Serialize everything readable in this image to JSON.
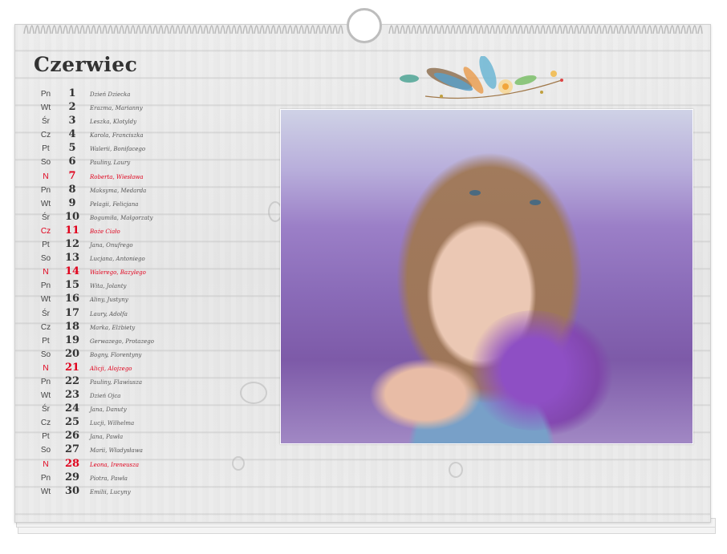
{
  "calendar": {
    "month": "Czerwiec",
    "days": [
      {
        "wd": "Pn",
        "num": "1",
        "name": "Dzień Dziecka",
        "holiday": false
      },
      {
        "wd": "Wt",
        "num": "2",
        "name": "Erazma, Marianny",
        "holiday": false
      },
      {
        "wd": "Śr",
        "num": "3",
        "name": "Leszka, Klotyldy",
        "holiday": false
      },
      {
        "wd": "Cz",
        "num": "4",
        "name": "Karola, Franciszka",
        "holiday": false
      },
      {
        "wd": "Pt",
        "num": "5",
        "name": "Walerii, Bonifacego",
        "holiday": false
      },
      {
        "wd": "So",
        "num": "6",
        "name": "Pauliny, Laury",
        "holiday": false
      },
      {
        "wd": "N",
        "num": "7",
        "name": "Roberta, Wiesława",
        "holiday": true
      },
      {
        "wd": "Pn",
        "num": "8",
        "name": "Maksyma, Medarda",
        "holiday": false
      },
      {
        "wd": "Wt",
        "num": "9",
        "name": "Pelagii, Felicjana",
        "holiday": false
      },
      {
        "wd": "Śr",
        "num": "10",
        "name": "Bogumiła, Małgorzaty",
        "holiday": false
      },
      {
        "wd": "Cz",
        "num": "11",
        "name": "Boże Ciało",
        "holiday": true
      },
      {
        "wd": "Pt",
        "num": "12",
        "name": "Jana, Onufrego",
        "holiday": false
      },
      {
        "wd": "So",
        "num": "13",
        "name": "Lucjana, Antoniego",
        "holiday": false
      },
      {
        "wd": "N",
        "num": "14",
        "name": "Walerego, Bazylego",
        "holiday": true
      },
      {
        "wd": "Pn",
        "num": "15",
        "name": "Wita, Jolanty",
        "holiday": false
      },
      {
        "wd": "Wt",
        "num": "16",
        "name": "Aliny, Justyny",
        "holiday": false
      },
      {
        "wd": "Śr",
        "num": "17",
        "name": "Laury, Adolfa",
        "holiday": false
      },
      {
        "wd": "Cz",
        "num": "18",
        "name": "Marka, Elżbiety",
        "holiday": false
      },
      {
        "wd": "Pt",
        "num": "19",
        "name": "Gerwazego, Protazego",
        "holiday": false
      },
      {
        "wd": "So",
        "num": "20",
        "name": "Bogny, Florentyny",
        "holiday": false
      },
      {
        "wd": "N",
        "num": "21",
        "name": "Alicji, Alojzego",
        "holiday": true
      },
      {
        "wd": "Pn",
        "num": "22",
        "name": "Pauliny, Flawiusza",
        "holiday": false
      },
      {
        "wd": "Wt",
        "num": "23",
        "name": "Dzień Ojca",
        "holiday": false
      },
      {
        "wd": "Śr",
        "num": "24",
        "name": "Jana, Danuty",
        "holiday": false
      },
      {
        "wd": "Cz",
        "num": "25",
        "name": "Lucji, Wilhelma",
        "holiday": false
      },
      {
        "wd": "Pt",
        "num": "26",
        "name": "Jana, Pawła",
        "holiday": false
      },
      {
        "wd": "So",
        "num": "27",
        "name": "Marii, Władysława",
        "holiday": false
      },
      {
        "wd": "N",
        "num": "28",
        "name": "Leona, Ireneusza",
        "holiday": true
      },
      {
        "wd": "Pn",
        "num": "29",
        "name": "Piotra, Pawła",
        "holiday": false
      },
      {
        "wd": "Wt",
        "num": "30",
        "name": "Emilii, Lucyny",
        "holiday": false
      }
    ]
  },
  "colors": {
    "holiday": "#e0001b",
    "text": "#333333"
  }
}
